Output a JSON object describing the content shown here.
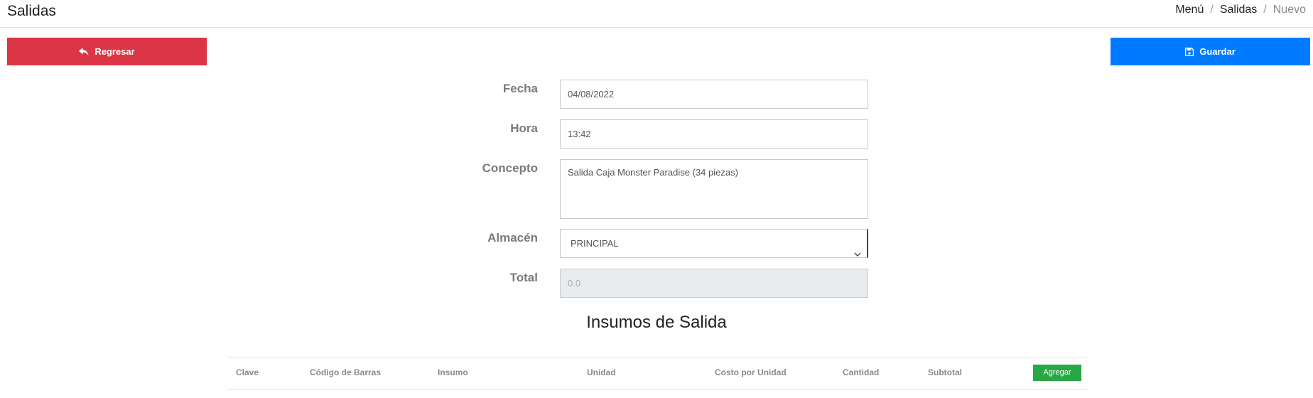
{
  "header": {
    "title": "Salidas",
    "breadcrumb": [
      "Menú",
      "Salidas",
      "Nuevo"
    ]
  },
  "actions": {
    "back_label": "Regresar",
    "save_label": "Guardar"
  },
  "form": {
    "fecha": {
      "label": "Fecha",
      "value": "04/08/2022"
    },
    "hora": {
      "label": "Hora",
      "value": "13:42"
    },
    "concepto": {
      "label": "Concepto",
      "value": "Salida Caja Monster Paradise (34 piezas)"
    },
    "almacen": {
      "label": "Almacén",
      "value": "PRINCIPAL"
    },
    "total": {
      "label": "Total",
      "value": "0.0"
    }
  },
  "items": {
    "title": "Insumos de Salida",
    "columns": [
      "Clave",
      "Código de Barras",
      "Insumo",
      "Unidad",
      "Costo por Unidad",
      "Cantidad",
      "Subtotal"
    ],
    "add_label": "Agregar"
  },
  "colors": {
    "danger": "#dc3545",
    "primary": "#007bff",
    "success": "#28a745"
  }
}
